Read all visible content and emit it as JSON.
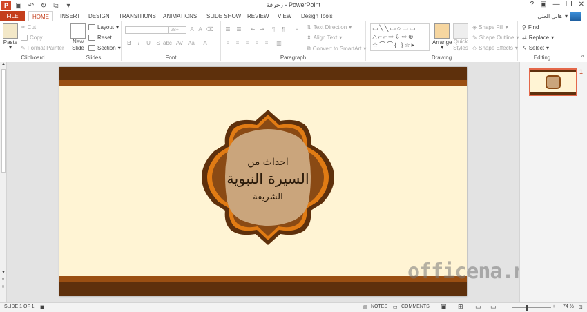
{
  "app": {
    "window_title": "زخرفة - PowerPoint"
  },
  "user": {
    "name": "هاني العلي"
  },
  "tabs": [
    {
      "label": "FILE",
      "id": "file"
    },
    {
      "label": "HOME",
      "id": "home"
    },
    {
      "label": "INSERT",
      "id": "insert"
    },
    {
      "label": "DESIGN",
      "id": "design"
    },
    {
      "label": "TRANSITIONS",
      "id": "transitions"
    },
    {
      "label": "ANIMATIONS",
      "id": "animations"
    },
    {
      "label": "SLIDE SHOW",
      "id": "slideshow"
    },
    {
      "label": "REVIEW",
      "id": "review"
    },
    {
      "label": "VIEW",
      "id": "view"
    },
    {
      "label": "Design Tools",
      "id": "designtools"
    }
  ],
  "ribbon": {
    "clipboard": {
      "label": "Clipboard",
      "paste": "Paste",
      "cut": "Cut",
      "copy": "Copy",
      "format_painter": "Format Painter"
    },
    "slides": {
      "label": "Slides",
      "new_slide": "New",
      "new_slide2": "Slide",
      "layout": "Layout",
      "reset": "Reset",
      "section": "Section"
    },
    "font": {
      "label": "Font",
      "size": "28+",
      "buttons": [
        "B",
        "I",
        "U",
        "S",
        "abc",
        "AV",
        "Aa",
        "A"
      ]
    },
    "paragraph": {
      "label": "Paragraph",
      "text_direction": "Text Direction",
      "align_text": "Align Text",
      "convert_smartart": "Convert to SmartArt"
    },
    "drawing": {
      "label": "Drawing",
      "arrange": "Arrange",
      "quick_styles": "Quick",
      "quick_styles2": "Styles",
      "shape_fill": "Shape Fill",
      "shape_outline": "Shape Outline",
      "shape_effects": "Shape Effects"
    },
    "editing": {
      "label": "Editing",
      "find": "Find",
      "replace": "Replace",
      "select": "Select"
    }
  },
  "slide": {
    "line1": "احداث من",
    "line2": "السيرة النبوية",
    "line3": "الشريفة"
  },
  "watermark": "officena.net",
  "thumbnail": {
    "number": "1"
  },
  "status": {
    "slide_of": "SLIDE 1 OF 1",
    "notes": "NOTES",
    "comments": "COMMENTS",
    "zoom": "74 %",
    "zoom_fraction": 0.74
  },
  "colors": {
    "accent": "#c43e1c",
    "band_dark": "#5e300c",
    "band_mid": "#9a4f12",
    "slide_bg": "#fff4d4",
    "badge_fill": "#caa57c"
  }
}
